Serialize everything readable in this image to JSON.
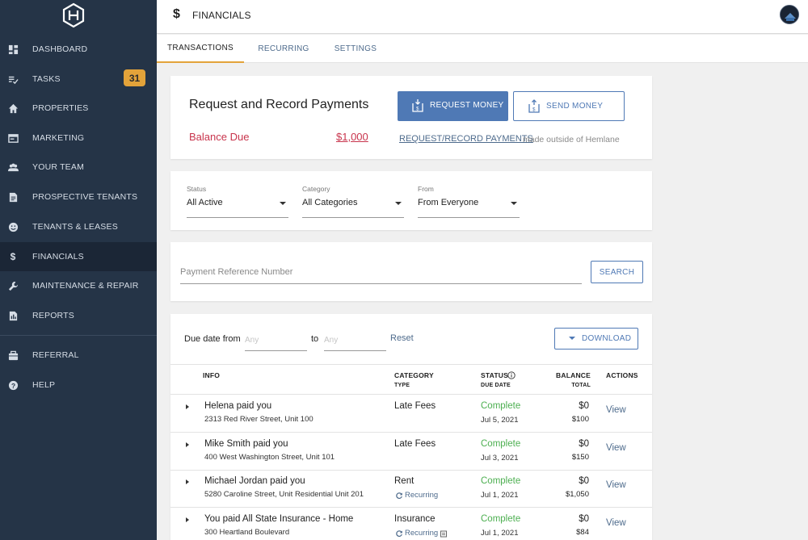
{
  "sidebar": {
    "items": [
      {
        "label": "DASHBOARD",
        "icon": "dashboard-icon"
      },
      {
        "label": "TASKS",
        "icon": "tasks-icon",
        "badge": "31"
      },
      {
        "label": "PROPERTIES",
        "icon": "home-icon"
      },
      {
        "label": "MARKETING",
        "icon": "marketing-icon"
      },
      {
        "label": "YOUR TEAM",
        "icon": "team-icon"
      },
      {
        "label": "PROSPECTIVE TENANTS",
        "icon": "document-icon"
      },
      {
        "label": "TENANTS & LEASES",
        "icon": "smiley-icon"
      },
      {
        "label": "FINANCIALS",
        "icon": "dollar-icon",
        "active": true
      },
      {
        "label": "MAINTENANCE & REPAIR",
        "icon": "wrench-icon"
      },
      {
        "label": "REPORTS",
        "icon": "report-icon"
      },
      {
        "label": "REFERRAL",
        "icon": "referral-icon"
      },
      {
        "label": "HELP",
        "icon": "help-icon"
      }
    ]
  },
  "header": {
    "dollar": "$",
    "title": "FINANCIALS"
  },
  "tabs": [
    {
      "label": "TRANSACTIONS",
      "active": true
    },
    {
      "label": "RECURRING"
    },
    {
      "label": "SETTINGS"
    }
  ],
  "payments": {
    "title": "Request and Record Payments",
    "balance_label": "Balance Due",
    "balance_amount": "$1,000",
    "request_button": "REQUEST MONEY",
    "send_button": "SEND MONEY",
    "record_link": "REQUEST/RECORD PAYMENTS",
    "record_suffix": "made outside of Hemlane"
  },
  "filters": [
    {
      "label": "Status",
      "value": "All Active"
    },
    {
      "label": "Category",
      "value": "All Categories"
    },
    {
      "label": "From",
      "value": "From Everyone"
    }
  ],
  "search": {
    "placeholder": "Payment Reference Number",
    "button": "SEARCH"
  },
  "transactions": {
    "due_from_label": "Due date from",
    "from_placeholder": "Any",
    "to_label": "to",
    "to_placeholder": "Any",
    "reset_label": "Reset",
    "download_label": "DOWNLOAD",
    "headers": {
      "info": "INFO",
      "category": "CATEGORY",
      "type": "TYPE",
      "status": "STATUS",
      "due_date": "DUE DATE",
      "balance": "BALANCE",
      "total": "TOTAL",
      "actions": "ACTIONS"
    },
    "rows": [
      {
        "title": "Helena paid you",
        "address": "2313 Red River Street, Unit 100",
        "category": "Late Fees",
        "recurring": "",
        "status": "Complete",
        "date": "Jul 5, 2021",
        "balance": "$0",
        "total": "$100",
        "action": "View"
      },
      {
        "title": "Mike Smith paid you",
        "address": "400 West Washington Street, Unit 101",
        "category": "Late Fees",
        "recurring": "",
        "status": "Complete",
        "date": "Jul 3, 2021",
        "balance": "$0",
        "total": "$150",
        "action": "View"
      },
      {
        "title": "Michael Jordan paid you",
        "address": "5280 Caroline Street, Unit Residential Unit 201",
        "category": "Rent",
        "recurring": "Recurring",
        "status": "Complete",
        "date": "Jul 1, 2021",
        "balance": "$0",
        "total": "$1,050",
        "action": "View"
      },
      {
        "title": "You paid All State Insurance - Home",
        "address": "300 Heartland Boulevard",
        "category": "Insurance",
        "recurring": "Recurring",
        "status": "Complete",
        "date": "Jul 1, 2021",
        "balance": "$0",
        "total": "$84",
        "action": "View"
      }
    ]
  },
  "colors": {
    "sidebar": "#253447",
    "accent": "#4f79b5",
    "badge": "#e3a33a",
    "balance": "#c8344c",
    "complete": "#4caf50"
  }
}
